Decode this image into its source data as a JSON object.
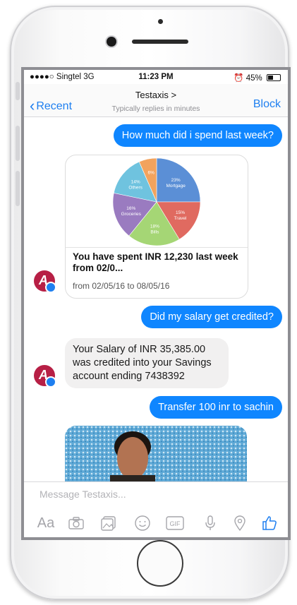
{
  "status_bar": {
    "carrier": "●●●●○ Singtel  3G",
    "time": "11:23 PM",
    "battery": "45%"
  },
  "header": {
    "back_label": "Recent",
    "title": "Testaxis >",
    "subtitle": "Typically replies in minutes",
    "block_label": "Block"
  },
  "messages": {
    "m1": "How much did i spend last week?",
    "card_heading": "You have spent INR 12,230 last week from 02/0...",
    "card_sub": "from 02/05/16 to 08/05/16",
    "m2": "Did my salary get credited?",
    "m3": "Your Salary of INR 35,385.00 was credited into your Savings account ending 7438392",
    "m4": "Transfer 100 inr to sachin"
  },
  "chart_data": {
    "type": "pie",
    "slices": [
      {
        "label": "Mortgage",
        "value": 23,
        "color": "#5b8fd6"
      },
      {
        "label": "Travel",
        "value": 15,
        "color": "#e06a60"
      },
      {
        "label": "Bills",
        "value": 18,
        "color": "#a5d675"
      },
      {
        "label": "Groceries",
        "value": 16,
        "color": "#9a7bc0"
      },
      {
        "label": "Others",
        "value": 14,
        "color": "#6fc3df"
      },
      {
        "label": "",
        "value": 6,
        "color": "#f2a35e"
      }
    ]
  },
  "composer": {
    "placeholder": "Message Testaxis..."
  },
  "toolbar_icons": [
    "text-format-icon",
    "camera-icon",
    "gallery-icon",
    "emoji-icon",
    "gif-icon",
    "microphone-icon",
    "location-icon",
    "thumbs-up-icon"
  ],
  "colors": {
    "accent": "#0f86ff",
    "avatar": "#b71f45"
  }
}
